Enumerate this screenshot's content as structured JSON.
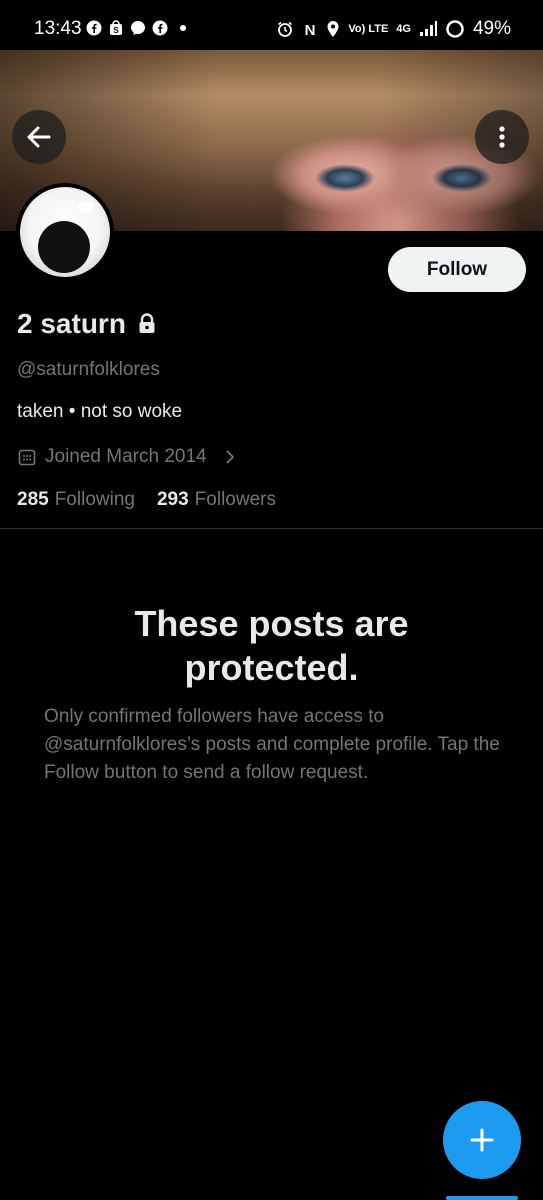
{
  "status_bar": {
    "time": "13:43",
    "network": "4G",
    "volte": "Vo) LTE",
    "battery": "49%",
    "left_icons": [
      "facebook-icon",
      "shopping-bag-icon",
      "messenger-icon",
      "facebook-icon",
      "dot-icon"
    ],
    "right_icons": [
      "alarm-icon",
      "nfc-icon",
      "location-icon",
      "volte-icon",
      "signal-icon",
      "battery-icon"
    ]
  },
  "header": {
    "back_icon": "arrow-left-icon",
    "more_icon": "more-vertical-icon"
  },
  "profile": {
    "follow_label": "Follow",
    "display_name": "2 saturn",
    "lock_icon": "lock-icon",
    "handle": "@saturnfolklores",
    "bio": "taken • not so woke",
    "joined": "Joined March 2014",
    "following_count": "285",
    "following_label": "Following",
    "followers_count": "293",
    "followers_label": "Followers"
  },
  "protected": {
    "title_line1": "These posts are",
    "title_line2": "protected.",
    "message": "Only confirmed followers have access to @saturnfolklores’s posts and complete profile. Tap the Follow button to send a follow request."
  },
  "fab": {
    "icon": "plus-icon"
  },
  "colors": {
    "background": "#000000",
    "accent": "#1d9bf0",
    "text_primary": "#e7e9ea",
    "text_secondary": "#71767b",
    "follow_bg": "#eff3f4"
  }
}
